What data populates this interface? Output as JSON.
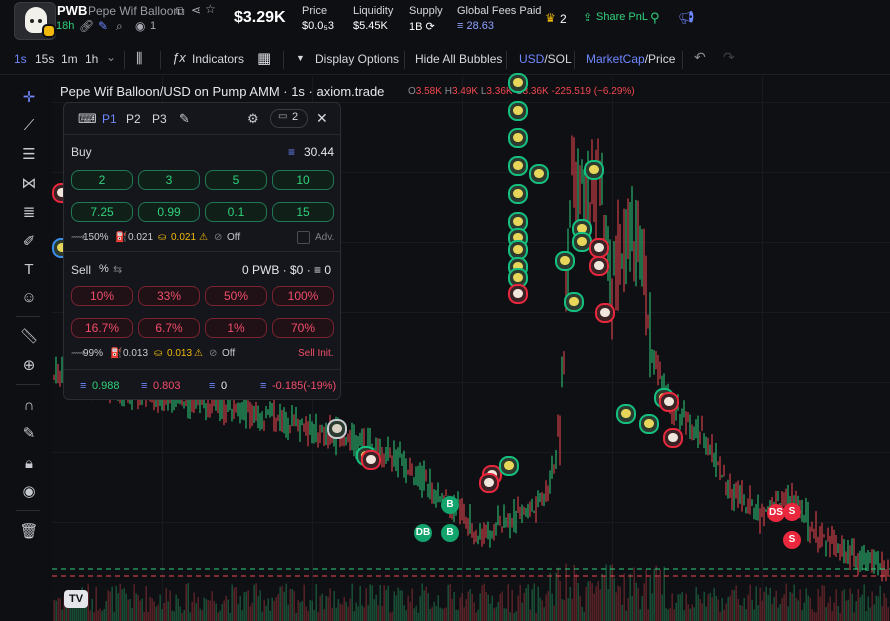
{
  "token": {
    "ticker": "PWB",
    "name": "Pepe Wif Balloon",
    "age": "18h",
    "holders_count": "1",
    "market_cap": "$3.29K"
  },
  "stats": [
    {
      "label": "Price",
      "value": "$0.0₅3"
    },
    {
      "label": "Liquidity",
      "value": "$5.45K"
    },
    {
      "label": "Supply",
      "value": "1B ⟳"
    },
    {
      "label": "Global Fees Paid",
      "value": "≡ 28.63"
    }
  ],
  "header_right": {
    "crown_count": "2",
    "share_pnl": "Share PnL"
  },
  "toolbar": {
    "intervals": [
      "1s",
      "15s",
      "1m",
      "1h"
    ],
    "active_interval": "1s",
    "indicators": "Indicators",
    "display_options": "Display Options",
    "hide_bubbles": "Hide All Bubbles",
    "currency_usd": "USD",
    "currency_sol": "/SOL",
    "mode_marketcap": "MarketCap",
    "mode_price": "/Price"
  },
  "chart": {
    "title": "Pepe Wif Balloon/USD on Pump AMM · 1s · axiom.trade",
    "ohlc": {
      "o_label": "O",
      "o": "3.58K",
      "h_label": "H",
      "h": "3.49K",
      "l_label": "L",
      "l": "3.36K",
      "c_label": "C",
      "c": "3.36K",
      "change": "-225.519 (−6.29%)"
    },
    "bubble_labels": {
      "buy": "B",
      "dev_buy": "DB",
      "sell": "S",
      "dev_sell": "DS"
    },
    "tv_logo": "TV"
  },
  "panel": {
    "presets": [
      "P1",
      "P2",
      "P3"
    ],
    "active_preset": "P1",
    "wallet_count": "2",
    "buy": {
      "label": "Buy",
      "balance": "30.44",
      "amounts": [
        "2",
        "3",
        "5",
        "10",
        "7.25",
        "0.99",
        "0.1",
        "15"
      ],
      "slippage": "150%",
      "priority": "0.021",
      "bribe": "0.021",
      "mev": "Off",
      "adv": "Adv."
    },
    "sell": {
      "label": "Sell",
      "unit": "%",
      "position": "0 PWB · $0 · ≡ 0",
      "amounts": [
        "10%",
        "33%",
        "50%",
        "100%",
        "16.7%",
        "6.7%",
        "1%",
        "70%"
      ],
      "slippage": "99%",
      "priority": "0.013",
      "bribe": "0.013",
      "mev": "Off",
      "sell_init": "Sell Init."
    },
    "summary": {
      "bought": "0.988",
      "sold": "0.803",
      "holding": "0",
      "pnl": "-0.185(-19%)"
    }
  },
  "colors": {
    "up": "#2fd17b",
    "down": "#f0484f",
    "accent": "#6f87ff",
    "panel_bg": "#15161b"
  }
}
